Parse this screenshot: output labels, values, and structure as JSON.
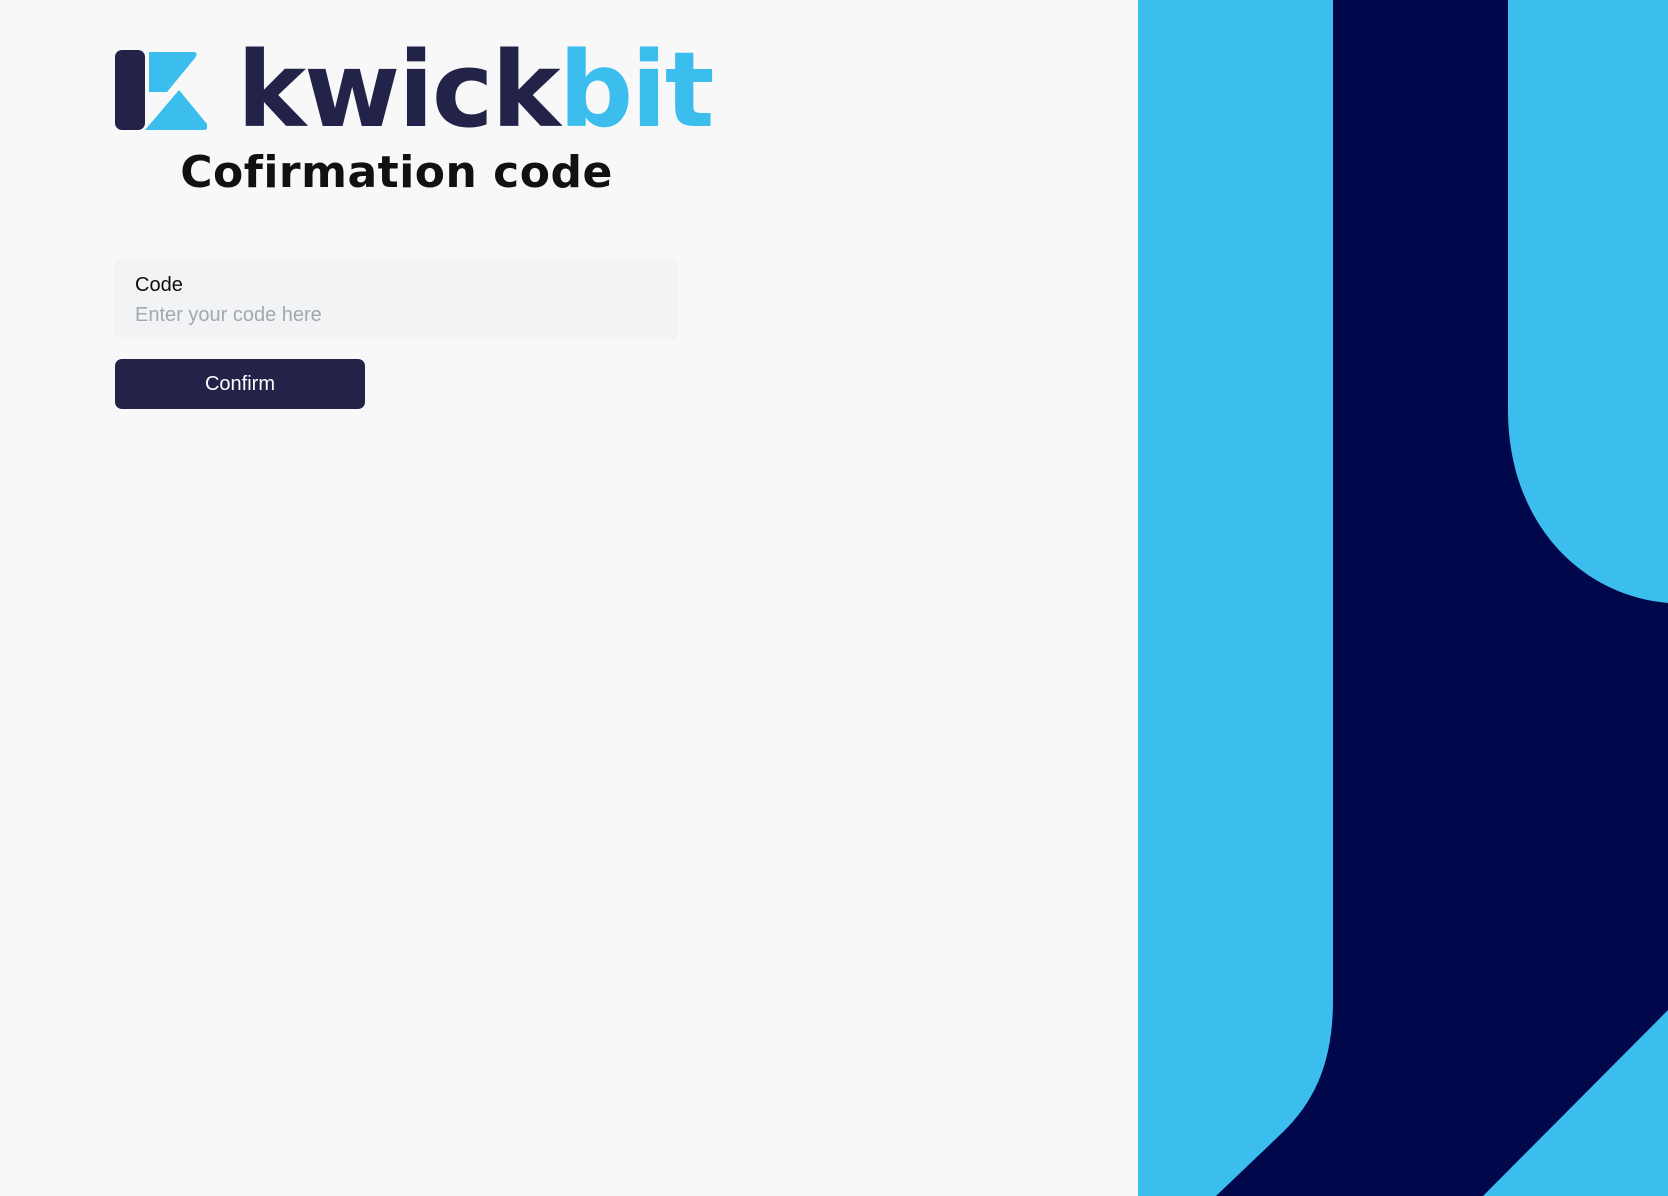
{
  "brand": {
    "name_part1": "kwick",
    "name_part2": "bit",
    "primary_color": "#23234a",
    "accent_color": "#3bbdee"
  },
  "page": {
    "title": "Cofirmation code"
  },
  "form": {
    "code_label": "Code",
    "code_placeholder": "Enter your code here",
    "code_value": "",
    "confirm_label": "Confirm"
  },
  "decoration": {
    "dark_color": "#00074a",
    "light_color": "#3bbdee"
  }
}
